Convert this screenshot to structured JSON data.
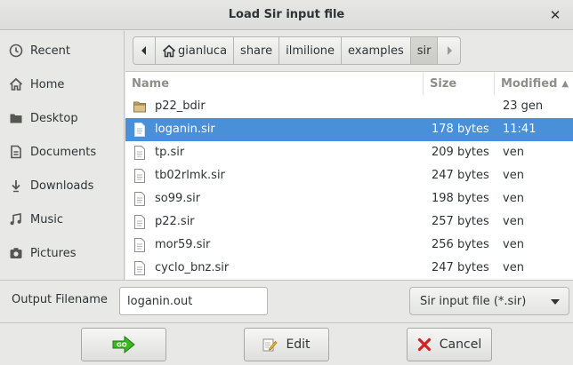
{
  "window": {
    "title": "Load Sir input file",
    "close_glyph": "✕"
  },
  "sidebar": {
    "items": [
      {
        "label": "Recent",
        "icon": "clock-icon"
      },
      {
        "label": "Home",
        "icon": "home-icon"
      },
      {
        "label": "Desktop",
        "icon": "desktop-icon"
      },
      {
        "label": "Documents",
        "icon": "documents-icon"
      },
      {
        "label": "Downloads",
        "icon": "downloads-icon"
      },
      {
        "label": "Music",
        "icon": "music-icon"
      },
      {
        "label": "Pictures",
        "icon": "pictures-icon"
      }
    ]
  },
  "pathbar": {
    "crumbs": [
      "gianluca",
      "share",
      "ilmilione",
      "examples",
      "sir"
    ],
    "active_crumb": "sir"
  },
  "filelist": {
    "columns": {
      "name": "Name",
      "size": "Size",
      "modified": "Modified"
    },
    "sort_indicator": "▲",
    "rows": [
      {
        "name": "p22_bdir",
        "size": "",
        "modified": "23 gen",
        "type": "folder",
        "selected": false
      },
      {
        "name": "loganin.sir",
        "size": "178 bytes",
        "modified": "11:41",
        "type": "file",
        "selected": true
      },
      {
        "name": "tp.sir",
        "size": "209 bytes",
        "modified": "ven",
        "type": "file",
        "selected": false
      },
      {
        "name": "tb02rlmk.sir",
        "size": "247 bytes",
        "modified": "ven",
        "type": "file",
        "selected": false
      },
      {
        "name": "so99.sir",
        "size": "198 bytes",
        "modified": "ven",
        "type": "file",
        "selected": false
      },
      {
        "name": "p22.sir",
        "size": "257 bytes",
        "modified": "ven",
        "type": "file",
        "selected": false
      },
      {
        "name": "mor59.sir",
        "size": "256 bytes",
        "modified": "ven",
        "type": "file",
        "selected": false
      },
      {
        "name": "cyclo_bnz.sir",
        "size": "247 bytes",
        "modified": "ven",
        "type": "file",
        "selected": false
      }
    ]
  },
  "output": {
    "label": "Output Filename",
    "value": "loganin.out"
  },
  "filter": {
    "value": "Sir input file (*.sir)"
  },
  "buttons": {
    "go": {
      "icon_text": "GO",
      "icon": "go-arrow-icon"
    },
    "edit": {
      "label": "Edit",
      "icon": "edit-icon"
    },
    "cancel": {
      "label": "Cancel",
      "icon": "cancel-x-icon"
    }
  },
  "colors": {
    "selection": "#4a90d9",
    "go_arrow": "#3cb521",
    "cancel_red": "#d52121"
  }
}
